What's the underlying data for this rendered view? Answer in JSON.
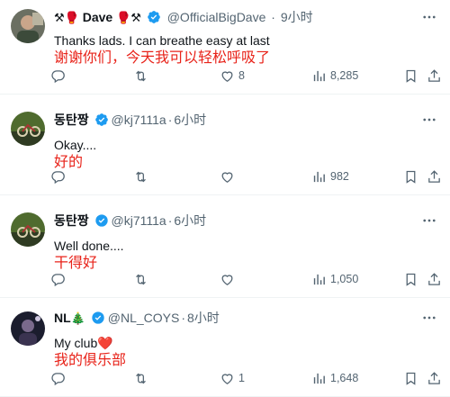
{
  "tweets": [
    {
      "name": "Dave",
      "name_prefix_emoji": "⚒🥊",
      "name_suffix_emoji": "🥊⚒",
      "handle": "@OfficialBigDave",
      "dot": "·",
      "time": "9小时",
      "text": "Thanks lads. I can breathe easy at last",
      "translation": "谢谢你们，今天我可以轻松呼吸了",
      "replies": "",
      "retweets": "",
      "likes": "8",
      "views": "8,285"
    },
    {
      "name": "동탄짱",
      "name_prefix_emoji": "",
      "name_suffix_emoji": "",
      "handle": "@kj7111a",
      "dot": "·",
      "time": "6小时",
      "text": "Okay....",
      "translation": "好的",
      "replies": "",
      "retweets": "",
      "likes": "",
      "views": "982"
    },
    {
      "name": "동탄짱",
      "name_prefix_emoji": "",
      "name_suffix_emoji": "",
      "handle": "@kj7111a",
      "dot": "·",
      "time": "6小时",
      "text": "Well done....",
      "translation": "干得好",
      "replies": "",
      "retweets": "",
      "likes": "",
      "views": "1,050"
    },
    {
      "name": "NL",
      "name_prefix_emoji": "",
      "name_suffix_emoji": "🎄",
      "handle": "@NL_COYS",
      "dot": "·",
      "time": "8小时",
      "text": "My club❤️",
      "translation": "我的俱乐部",
      "replies": "",
      "retweets": "",
      "likes": "1",
      "views": "1,648"
    }
  ],
  "colors": {
    "verified": "#1d9bf0",
    "translation": "#e8231a",
    "muted": "#536471"
  }
}
